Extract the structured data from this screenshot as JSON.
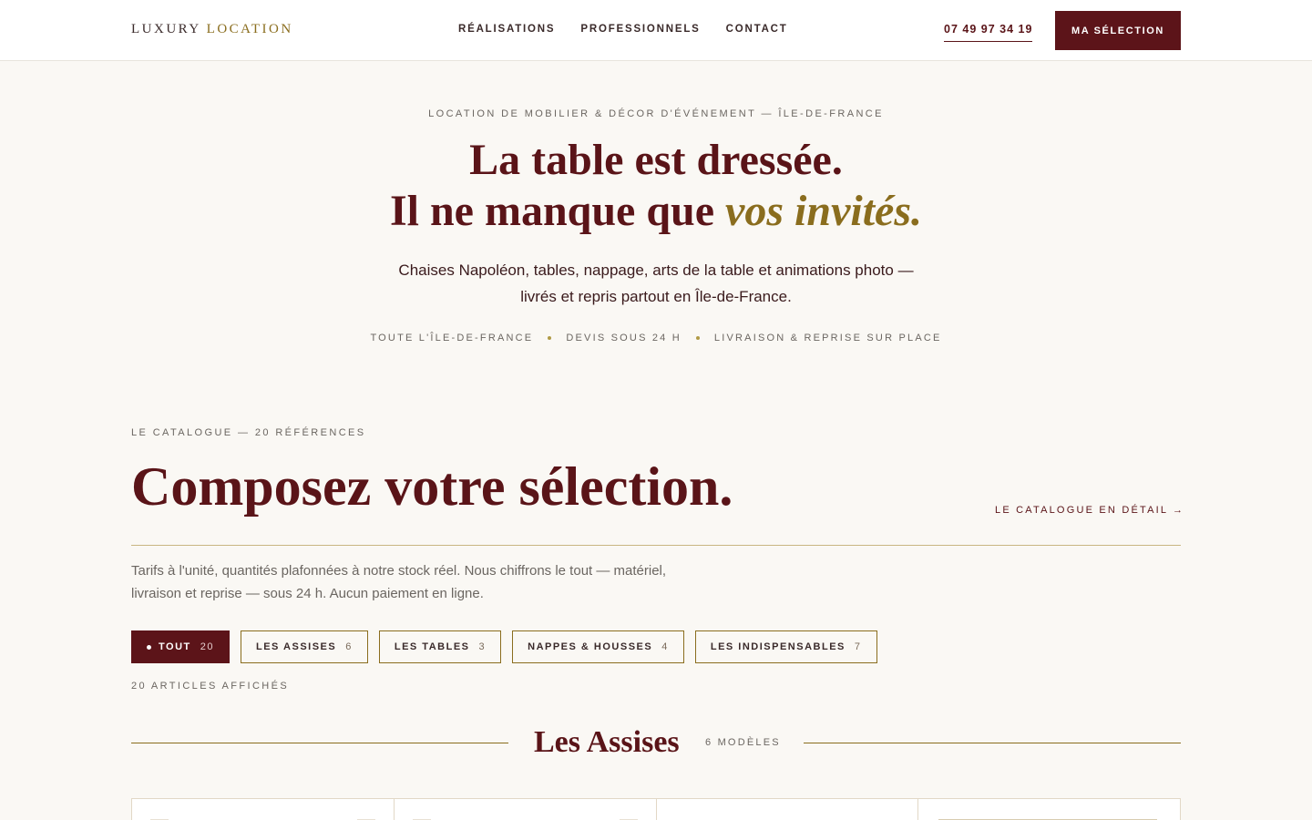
{
  "header": {
    "logo_main": "LUXURY",
    "logo_accent": "LOCATION",
    "nav": [
      "RÉALISATIONS",
      "PROFESSIONNELS",
      "CONTACT"
    ],
    "phone": "07 49 97 34 19",
    "cta": "MA SÉLECTION"
  },
  "hero": {
    "eyebrow": "LOCATION DE MOBILIER & DÉCOR D'ÉVÉNEMENT — ÎLE-DE-FRANCE",
    "title_line1": "La table est dressée.",
    "title_line2_start": "Il ne manque que ",
    "title_line2_accent": "vos invités.",
    "subtitle": "Chaises Napoléon, tables, nappage, arts de la table et animations photo — livrés et repris partout en Île-de-France.",
    "badges": [
      "TOUTE L'ÎLE-DE-FRANCE",
      "DEVIS SOUS 24 H",
      "LIVRAISON & REPRISE SUR PLACE"
    ]
  },
  "catalogue": {
    "eyebrow": "LE CATALOGUE — 20 RÉFÉRENCES",
    "title": "Composez votre sélection.",
    "link": "LE CATALOGUE EN DÉTAIL →",
    "description": "Tarifs à l'unité, quantités plafonnées à notre stock réel. Nous chiffrons le tout — matériel, livraison et reprise — sous 24 h. Aucun paiement en ligne.",
    "filters": [
      {
        "label": "TOUT",
        "count": "20",
        "active": true
      },
      {
        "label": "LES ASSISES",
        "count": "6",
        "active": false
      },
      {
        "label": "LES TABLES",
        "count": "3",
        "active": false
      },
      {
        "label": "NAPPES & HOUSSES",
        "count": "4",
        "active": false
      },
      {
        "label": "LES INDISPENSABLES",
        "count": "7",
        "active": false
      }
    ],
    "shown": "20 ARTICLES AFFICHÉS",
    "section_title": "Les Assises",
    "section_count": "6 MODÈLES"
  },
  "colors": {
    "burgundy": "#5c1419",
    "gold": "#8a6d1e",
    "background": "#faf8f4"
  }
}
